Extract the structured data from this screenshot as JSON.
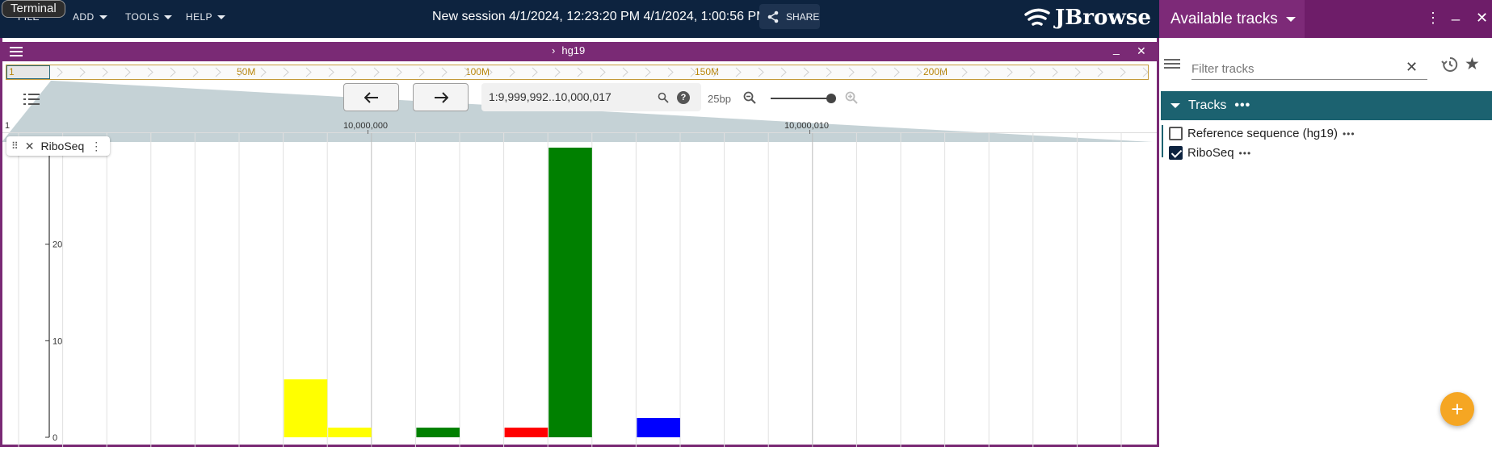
{
  "appbar": {
    "menus": [
      "FILE",
      "ADD",
      "TOOLS",
      "HELP"
    ],
    "tooltip": "Terminal",
    "session_title": "New session 4/1/2024, 12:23:20 PM 4/1/2024, 1:00:56 PM",
    "share_label": "SHARE",
    "logo_text": "JBrowse"
  },
  "right_panel": {
    "title": "Available tracks",
    "filter_placeholder": "Filter tracks",
    "category": "Tracks",
    "tracks": [
      {
        "label": "Reference sequence (hg19)",
        "checked": false
      },
      {
        "label": "RiboSeq",
        "checked": true
      }
    ]
  },
  "view": {
    "assembly": "hg19",
    "overview_labels": [
      "1",
      "50M",
      "100M",
      "150M",
      "200M"
    ],
    "location": "1:9,999,992..10,000,017",
    "bp_per_px": "25bp",
    "coord_labels": [
      "1",
      "10,000,000",
      "10,000,010"
    ],
    "track_name": "RiboSeq",
    "axis_ticks": [
      "20",
      "10",
      "0"
    ]
  },
  "chart_data": {
    "type": "bar",
    "ylim": [
      0,
      30
    ],
    "bars": [
      {
        "position": 9999998,
        "value": 6,
        "color": "#ffff00"
      },
      {
        "position": 9999999,
        "value": 1,
        "color": "#ffff00"
      },
      {
        "position": 10000001,
        "value": 1,
        "color": "#008000"
      },
      {
        "position": 10000003,
        "value": 1,
        "color": "#ff0000"
      },
      {
        "position": 10000004,
        "value": 30,
        "color": "#008000"
      },
      {
        "position": 10000006,
        "value": 2,
        "color": "#0000ff"
      }
    ]
  }
}
